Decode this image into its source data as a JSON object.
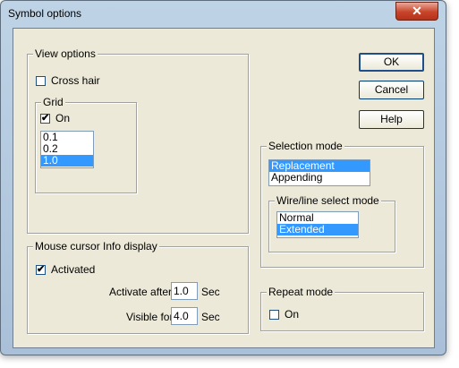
{
  "window": {
    "title": "Symbol options",
    "close_glyph": "✕"
  },
  "buttons": {
    "ok": "OK",
    "cancel": "Cancel",
    "help": "Help"
  },
  "view_options": {
    "legend": "View options",
    "cross_hair": {
      "label": "Cross hair",
      "checked": false
    },
    "grid": {
      "legend": "Grid",
      "on": {
        "label": "On",
        "checked": true
      },
      "items": [
        "0.1",
        "0.2",
        "1.0"
      ],
      "selected": "1.0"
    }
  },
  "mouse_cursor": {
    "legend": "Mouse cursor Info display",
    "activated": {
      "label": "Activated",
      "checked": true
    },
    "activate_after": {
      "label": "Activate after",
      "value": "1.0",
      "unit": "Sec"
    },
    "visible_for": {
      "label": "Visible for",
      "value": "4.0",
      "unit": "Sec"
    }
  },
  "selection_mode": {
    "legend": "Selection mode",
    "items": [
      "Replacement",
      "Appending"
    ],
    "selected": "Replacement",
    "wire_line": {
      "legend": "Wire/line select mode",
      "items": [
        "Normal",
        "Extended"
      ],
      "selected": "Extended"
    }
  },
  "repeat_mode": {
    "legend": "Repeat mode",
    "on": {
      "label": "On",
      "checked": false
    }
  },
  "check_glyph": "✔",
  "colors": {
    "selection": "#3399ff",
    "dialog_bg": "#ece9d8",
    "close_button": "#c8442a"
  }
}
